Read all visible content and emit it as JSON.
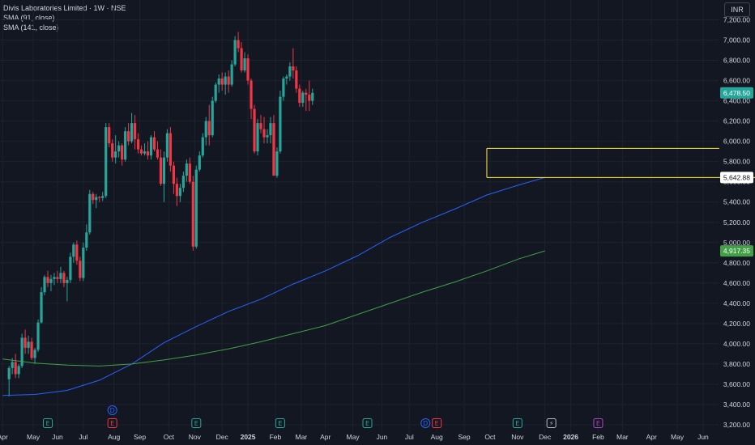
{
  "legend": {
    "title": "Divis Laboratories Limited · 1W · NSE",
    "sma1": "SMA (91, close)",
    "sma2": "SMA (141, close)"
  },
  "currency": "INR",
  "colors": {
    "background": "#131722",
    "up": "#26a69a",
    "down": "#f23645",
    "sma91": "#2962ff",
    "sma141": "#43a047",
    "annotation": "#ffeb3b",
    "axis_text": "#d1d4dc",
    "grid": "#1e222d"
  },
  "chart_data": {
    "type": "candlestick",
    "ylim": [
      3160,
      7300
    ],
    "y_ticks": [
      3200,
      3400,
      3600,
      3800,
      4000,
      4200,
      4400,
      4600,
      4800,
      5000,
      5200,
      5400,
      5600,
      5800,
      6000,
      6200,
      6400,
      6600,
      6800,
      7000,
      7200
    ],
    "y_tick_labels": [
      "3,200.00",
      "3,400.00",
      "3,600.00",
      "3,800.00",
      "4,000.00",
      "4,200.00",
      "4,400.00",
      "4,600.00",
      "4,800.00",
      "5,000.00",
      "5,200.00",
      "5,400.00",
      "5,600.00",
      "5,800.00",
      "6,000.00",
      "6,200.00",
      "6,400.00",
      "6,600.00",
      "6,800.00",
      "7,000.00",
      "7,200.00"
    ],
    "x_ticks": [
      "Apr",
      "May",
      "Jun",
      "Jul",
      "Aug",
      "Sep",
      "Oct",
      "Nov",
      "Dec",
      "2025",
      "Feb",
      "Mar",
      "Apr",
      "May",
      "Jun",
      "Jul",
      "Aug",
      "Sep",
      "Oct",
      "Nov",
      "Dec",
      "2026",
      "Feb",
      "Mar",
      "Apr",
      "May",
      "Jun"
    ],
    "x_tick_weeks": [
      0,
      9.5,
      17,
      25,
      34.5,
      42.5,
      51.5,
      59.5,
      68,
      76,
      84.5,
      92.5,
      100,
      108.5,
      117.5,
      126,
      134.5,
      143,
      151,
      159.5,
      168,
      176,
      184.5,
      192,
      201,
      209,
      217
    ],
    "start_week": 2,
    "candles": [
      [
        3650,
        3780,
        3480,
        3760
      ],
      [
        3760,
        3860,
        3700,
        3820
      ],
      [
        3820,
        3900,
        3660,
        3700
      ],
      [
        3700,
        3800,
        3660,
        3780
      ],
      [
        3780,
        4100,
        3760,
        4060
      ],
      [
        4060,
        4140,
        3900,
        3960
      ],
      [
        3960,
        4080,
        3900,
        4020
      ],
      [
        4020,
        4060,
        3840,
        3860
      ],
      [
        3860,
        3960,
        3800,
        3940
      ],
      [
        3940,
        4240,
        3920,
        4210
      ],
      [
        4210,
        4560,
        4200,
        4510
      ],
      [
        4510,
        4680,
        4480,
        4660
      ],
      [
        4660,
        4720,
        4560,
        4600
      ],
      [
        4600,
        4680,
        4520,
        4640
      ],
      [
        4640,
        4700,
        4580,
        4660
      ],
      [
        4660,
        4720,
        4600,
        4640
      ],
      [
        4640,
        4760,
        4600,
        4700
      ],
      [
        4700,
        4720,
        4560,
        4600
      ],
      [
        4600,
        4660,
        4420,
        4630
      ],
      [
        4630,
        4900,
        4600,
        4860
      ],
      [
        4860,
        5000,
        4800,
        4980
      ],
      [
        4980,
        5020,
        4780,
        4820
      ],
      [
        4820,
        4860,
        4620,
        4650
      ],
      [
        4650,
        5000,
        4620,
        4950
      ],
      [
        4950,
        5180,
        4920,
        5100
      ],
      [
        5100,
        5520,
        5080,
        5480
      ],
      [
        5480,
        5500,
        5380,
        5420
      ],
      [
        5420,
        5480,
        5340,
        5450
      ],
      [
        5450,
        5460,
        5400,
        5440
      ],
      [
        5440,
        5500,
        5410,
        5460
      ],
      [
        5460,
        6180,
        5440,
        6140
      ],
      [
        6140,
        6180,
        5940,
        5980
      ],
      [
        5980,
        6020,
        5800,
        5840
      ],
      [
        5840,
        6060,
        5780,
        5900
      ],
      [
        5900,
        6000,
        5840,
        5960
      ],
      [
        5960,
        5980,
        5760,
        5820
      ],
      [
        5820,
        6140,
        5800,
        6100
      ],
      [
        6100,
        6180,
        5960,
        6000
      ],
      [
        6000,
        6280,
        5980,
        6180
      ],
      [
        6180,
        6260,
        5920,
        6020
      ],
      [
        6020,
        6080,
        5880,
        5920
      ],
      [
        5920,
        5960,
        5860,
        5880
      ],
      [
        5880,
        5980,
        5860,
        5900
      ],
      [
        5900,
        6000,
        5820,
        5860
      ],
      [
        5860,
        6060,
        5820,
        6040
      ],
      [
        6040,
        6100,
        5900,
        5920
      ],
      [
        5920,
        6000,
        5820,
        5840
      ],
      [
        5840,
        5920,
        5560,
        5580
      ],
      [
        5580,
        5900,
        5400,
        5840
      ],
      [
        5840,
        6120,
        5800,
        6080
      ],
      [
        6080,
        6140,
        5700,
        5760
      ],
      [
        5760,
        5800,
        5480,
        5580
      ],
      [
        5580,
        5640,
        5360,
        5460
      ],
      [
        5460,
        5580,
        5400,
        5540
      ],
      [
        5540,
        5700,
        5500,
        5660
      ],
      [
        5660,
        5820,
        5600,
        5780
      ],
      [
        5780,
        5840,
        5580,
        5600
      ],
      [
        5600,
        5660,
        4920,
        4960
      ],
      [
        4960,
        5760,
        4940,
        5720
      ],
      [
        5720,
        5900,
        5700,
        5860
      ],
      [
        5860,
        6080,
        5840,
        6040
      ],
      [
        6040,
        6240,
        5960,
        6200
      ],
      [
        6200,
        6360,
        5960,
        6060
      ],
      [
        6060,
        6440,
        6040,
        6400
      ],
      [
        6400,
        6580,
        6380,
        6560
      ],
      [
        6560,
        6660,
        6480,
        6620
      ],
      [
        6620,
        6680,
        6500,
        6560
      ],
      [
        6560,
        6680,
        6460,
        6640
      ],
      [
        6640,
        6700,
        6480,
        6560
      ],
      [
        6560,
        6800,
        6540,
        6760
      ],
      [
        6760,
        7040,
        6740,
        7000
      ],
      [
        7000,
        7080,
        6880,
        6920
      ],
      [
        6920,
        6980,
        6680,
        6700
      ],
      [
        6700,
        6880,
        6680,
        6820
      ],
      [
        6820,
        6860,
        6560,
        6600
      ],
      [
        6600,
        6620,
        6220,
        6320
      ],
      [
        6320,
        6360,
        5880,
        5900
      ],
      [
        5900,
        6220,
        5860,
        6180
      ],
      [
        6180,
        6260,
        6080,
        6120
      ],
      [
        6120,
        6240,
        5980,
        6040
      ],
      [
        6040,
        6120,
        5980,
        6060
      ],
      [
        6060,
        6240,
        5980,
        6180
      ],
      [
        6180,
        6260,
        5680,
        5660
      ],
      [
        5660,
        5940,
        5640,
        5900
      ],
      [
        5900,
        6500,
        5880,
        6440
      ],
      [
        6440,
        6640,
        6400,
        6620
      ],
      [
        6620,
        6660,
        6560,
        6640
      ],
      [
        6640,
        6780,
        6600,
        6740
      ],
      [
        6740,
        6920,
        6620,
        6700
      ],
      [
        6700,
        6740,
        6480,
        6520
      ],
      [
        6520,
        6560,
        6340,
        6380
      ],
      [
        6380,
        6500,
        6340,
        6480
      ],
      [
        6480,
        6520,
        6300,
        6460
      ],
      [
        6460,
        6600,
        6300,
        6400
      ],
      [
        6400,
        6520,
        6360,
        6478.5
      ]
    ],
    "sma91": {
      "name": "SMA (91, close)",
      "weeks": [
        0,
        10,
        20,
        30,
        40,
        50,
        60,
        70,
        80,
        90,
        100,
        110,
        120,
        130,
        140,
        150,
        160,
        168
      ],
      "values": [
        3490,
        3500,
        3540,
        3640,
        3800,
        4010,
        4170,
        4320,
        4440,
        4590,
        4720,
        4870,
        5050,
        5200,
        5330,
        5470,
        5570,
        5642.88
      ]
    },
    "sma141": {
      "name": "SMA (141, close)",
      "weeks": [
        0,
        10,
        20,
        30,
        40,
        50,
        60,
        70,
        80,
        90,
        100,
        110,
        120,
        130,
        140,
        150,
        160,
        168
      ],
      "values": [
        3850,
        3810,
        3790,
        3780,
        3800,
        3840,
        3890,
        3950,
        4020,
        4100,
        4180,
        4290,
        4400,
        4510,
        4610,
        4720,
        4840,
        4917.35
      ]
    },
    "annotations": [
      {
        "type": "box",
        "x0": 150,
        "x1": 222,
        "y0": 5642.88,
        "y1": 5930
      }
    ],
    "last_price": {
      "value": 6478.5,
      "label": "6,478.50"
    },
    "price_labels": [
      {
        "value": 5642.88,
        "label": "5,642.88",
        "style": "white"
      },
      {
        "value": 4917.35,
        "label": "4,917.35",
        "style": "green"
      }
    ],
    "event_markers": [
      {
        "week": 34,
        "letter": "D",
        "row": 0,
        "color": "#2962ff"
      },
      {
        "week": 14,
        "letter": "E",
        "row": 1,
        "color": "#26a69a"
      },
      {
        "week": 34,
        "letter": "E",
        "row": 1,
        "color": "#f23645"
      },
      {
        "week": 60,
        "letter": "E",
        "row": 1,
        "color": "#26a69a"
      },
      {
        "week": 86,
        "letter": "E",
        "row": 1,
        "color": "#26a69a"
      },
      {
        "week": 113,
        "letter": "E",
        "row": 1,
        "color": "#26a69a"
      },
      {
        "week": 131,
        "letter": "D",
        "row": 1,
        "color": "#2962ff"
      },
      {
        "week": 134.5,
        "letter": "E",
        "row": 1,
        "color": "#f23645"
      },
      {
        "week": 159.5,
        "letter": "E",
        "row": 1,
        "color": "#26a69a"
      },
      {
        "week": 170,
        "letter": "⚡",
        "row": 1,
        "color": "#b2b5be"
      },
      {
        "week": 184.5,
        "letter": "E",
        "row": 1,
        "color": "#ab47bc"
      }
    ]
  }
}
